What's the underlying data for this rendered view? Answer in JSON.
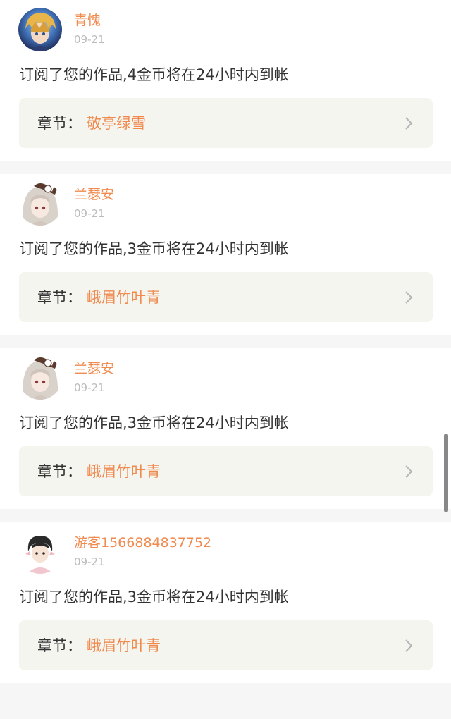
{
  "notifications": [
    {
      "username": "青愧",
      "date": "09-21",
      "message": "订阅了您的作品,4金币将在24小时内到帐",
      "chapter_prefix": "章节：",
      "chapter_title": "敬亭绿雪"
    },
    {
      "username": "兰瑟安",
      "date": "09-21",
      "message": "订阅了您的作品,3金币将在24小时内到帐",
      "chapter_prefix": "章节：",
      "chapter_title": "峨眉竹叶青"
    },
    {
      "username": "兰瑟安",
      "date": "09-21",
      "message": "订阅了您的作品,3金币将在24小时内到帐",
      "chapter_prefix": "章节：",
      "chapter_title": "峨眉竹叶青"
    },
    {
      "username": "游客1566884837752",
      "date": "09-21",
      "message": "订阅了您的作品,3金币将在24小时内到帐",
      "chapter_prefix": "章节：",
      "chapter_title": "峨眉竹叶青"
    }
  ],
  "icons": {
    "chevron": "chevron-right-icon",
    "avatars": [
      "anime-boy-avatar",
      "anime-girl-avatar",
      "anime-girl-avatar",
      "anime-boy-avatar"
    ]
  },
  "colors": {
    "accent": "#f08a4e",
    "text": "#333333",
    "muted": "#bcbcbc",
    "chapter_box": "#f5f5f0",
    "page_bg": "#f6f6f6"
  }
}
